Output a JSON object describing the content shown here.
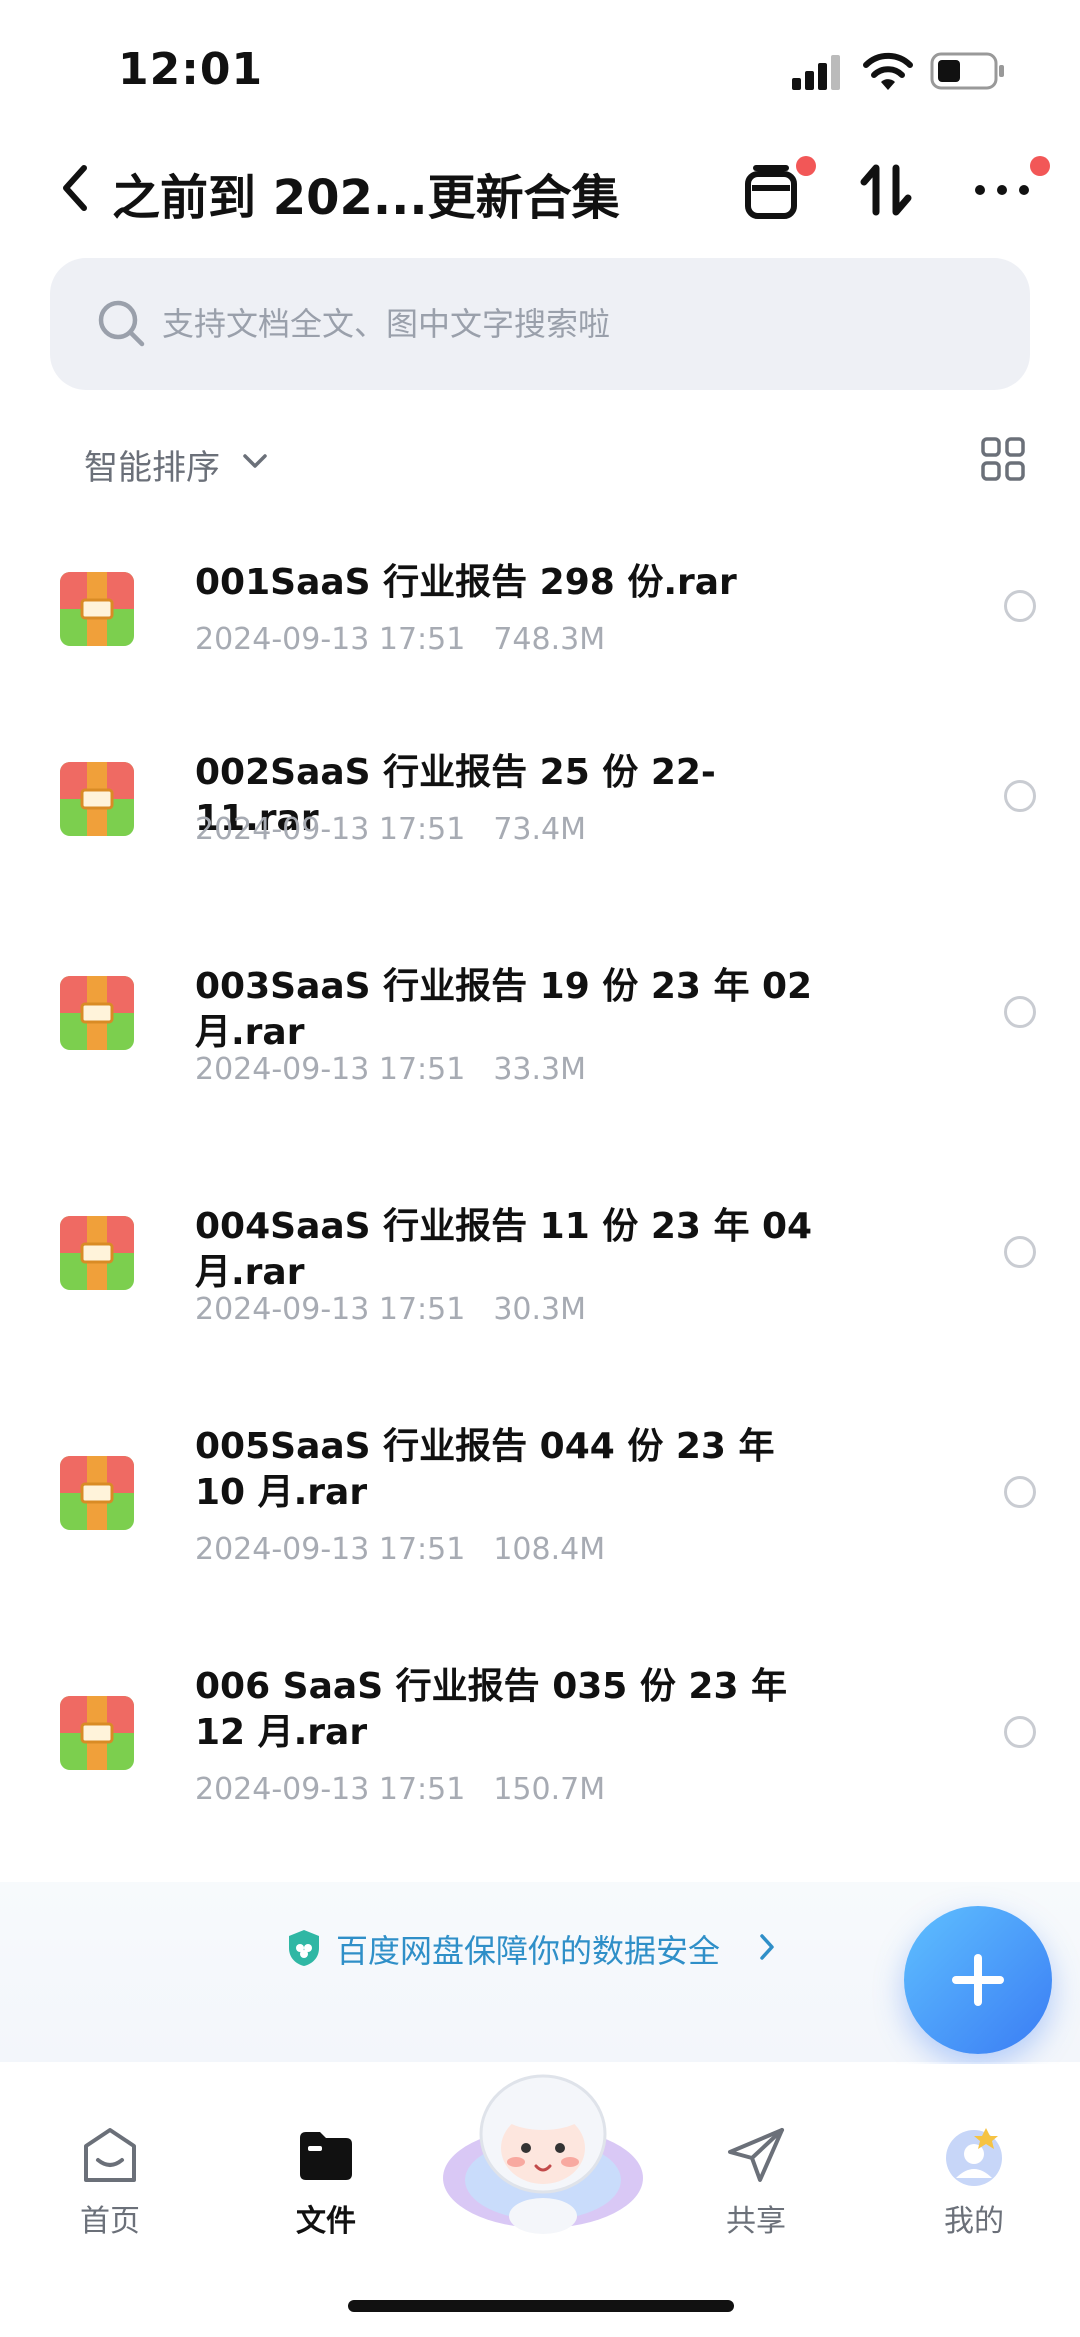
{
  "status_bar": {
    "time": "12:01"
  },
  "header": {
    "title": "之前到 202...更新合集",
    "icons": [
      "back-icon",
      "archive-icon",
      "sort-arrows-icon",
      "more-icon"
    ]
  },
  "search": {
    "placeholder": "支持文档全文、图中文字搜索啦"
  },
  "sort": {
    "label": "智能排序"
  },
  "files": [
    {
      "name": "001SaaS 行业报告 298 份.rar",
      "date": "2024-09-13 17:51",
      "size": "748.3M"
    },
    {
      "name": "002SaaS 行业报告 25 份 22-11.rar",
      "date": "2024-09-13 17:51",
      "size": "73.4M"
    },
    {
      "name": "003SaaS 行业报告 19 份 23 年 02 月.rar",
      "date": "2024-09-13 17:51",
      "size": "33.3M"
    },
    {
      "name": "004SaaS 行业报告 11 份 23 年 04 月.rar",
      "date": "2024-09-13 17:51",
      "size": "30.3M"
    },
    {
      "name": "005SaaS 行业报告 044 份 23 年 10 月.rar",
      "date": "2024-09-13 17:51",
      "size": "108.4M"
    },
    {
      "name": "006 SaaS 行业报告 035 份 23 年 12 月.rar",
      "date": "2024-09-13 17:51",
      "size": "150.7M"
    }
  ],
  "banner": {
    "text": "百度网盘保障你的数据安全"
  },
  "tabs": [
    {
      "label": "首页",
      "icon": "home-icon"
    },
    {
      "label": "文件",
      "icon": "folder-icon"
    },
    {
      "label": "共享",
      "icon": "share-icon"
    },
    {
      "label": "我的",
      "icon": "profile-icon"
    }
  ],
  "colors": {
    "accent": "#3a7cf4",
    "badge": "#f25757",
    "banner_text": "#2f8fc8"
  }
}
